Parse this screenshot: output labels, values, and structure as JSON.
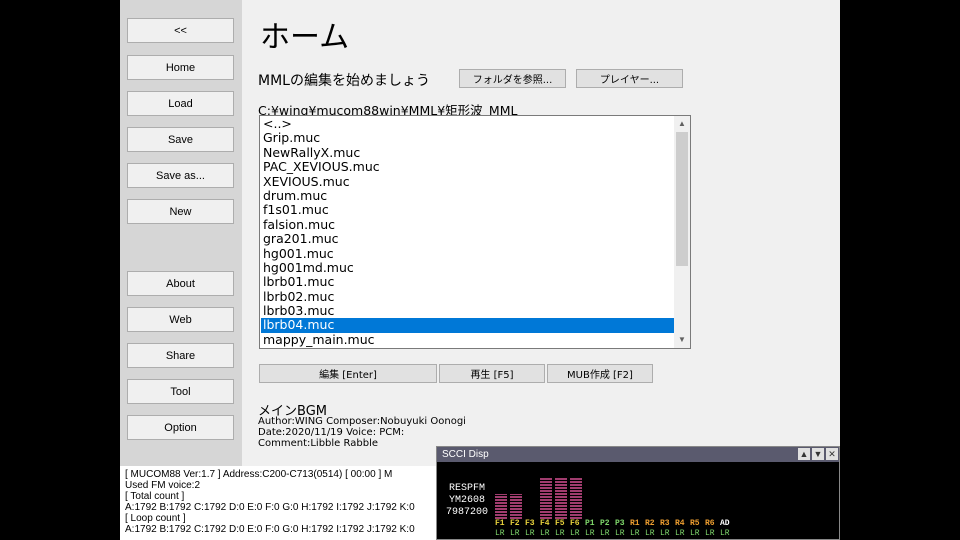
{
  "sidebar": {
    "collapse": "<<",
    "items": [
      "Home",
      "Load",
      "Save",
      "Save as...",
      "New",
      "About",
      "Web",
      "Share",
      "Tool",
      "Option"
    ]
  },
  "main": {
    "title": "ホーム",
    "prompt": "MMLの編集を始めましょう",
    "browse_button": "フォルダを参照...",
    "player_button": "プレイヤー...",
    "path": "C:¥wing¥mucom88win¥MML¥矩形波_MML",
    "files": [
      "<..>",
      "Grip.muc",
      "NewRallyX.muc",
      "PAC_XEVIOUS.muc",
      "XEVIOUS.muc",
      "drum.muc",
      "f1s01.muc",
      "falsion.muc",
      "gra201.muc",
      "hg001.muc",
      "hg001md.muc",
      "lbrb01.muc",
      "lbrb02.muc",
      "lbrb03.muc",
      "lbrb04.muc",
      "mappy_main.muc"
    ],
    "selected_file": "lbrb04.muc",
    "edit_button": "編集 [Enter]",
    "play_button": "再生 [F5]",
    "mub_button": "MUB作成 [F2]",
    "song_title": "メインBGM",
    "meta_line1": "Author:WING  Composer:Nobuyuki Oonogi",
    "meta_line2": "Date:2020/11/19  Voice:  PCM:",
    "meta_line3": "Comment:Libble Rabble"
  },
  "console": {
    "line1": "[  MUCOM88 Ver:1.7  ]  Address:C200-C713(0514)          [ 00:00 ]  M",
    "line2": "Used FM voice:2",
    "line3": "[ Total count ]",
    "line4": "A:1792 B:1792 C:1792 D:0 E:0 F:0 G:0 H:1792 I:1792 J:1792 K:0",
    "line5": "[ Loop count  ]",
    "line6": "A:1792 B:1792 C:1792 D:0 E:0 F:0 G:0 H:1792 I:1792 J:1792 K:0"
  },
  "scci": {
    "title": "SCCI Disp",
    "chip_name": "RESPFM",
    "chip_model": "YM2608",
    "chip_clock": "7987200",
    "channels": [
      "F1",
      "F2",
      "F3",
      "F4",
      "F5",
      "F6",
      "P1",
      "P2",
      "P3",
      "R1",
      "R2",
      "R3",
      "R4",
      "R5",
      "R6",
      "AD"
    ],
    "channel_lr": [
      "LR",
      "LR",
      "LR",
      "LR",
      "LR",
      "LR",
      "LR",
      "LR",
      "LR",
      "LR",
      "LR",
      "LR",
      "LR",
      "LR",
      "LR",
      "LR"
    ],
    "levels": [
      0.45,
      0.45,
      0,
      0.75,
      0.75,
      0.75,
      0,
      0,
      0,
      0,
      0,
      0,
      0,
      0,
      0,
      0
    ],
    "colors": {
      "fm": "#e8d23c",
      "ssg": "#7fd86b",
      "rhythm": "#f0a030",
      "adpcm": "#ffffff",
      "meter": "#a03c6e"
    }
  }
}
